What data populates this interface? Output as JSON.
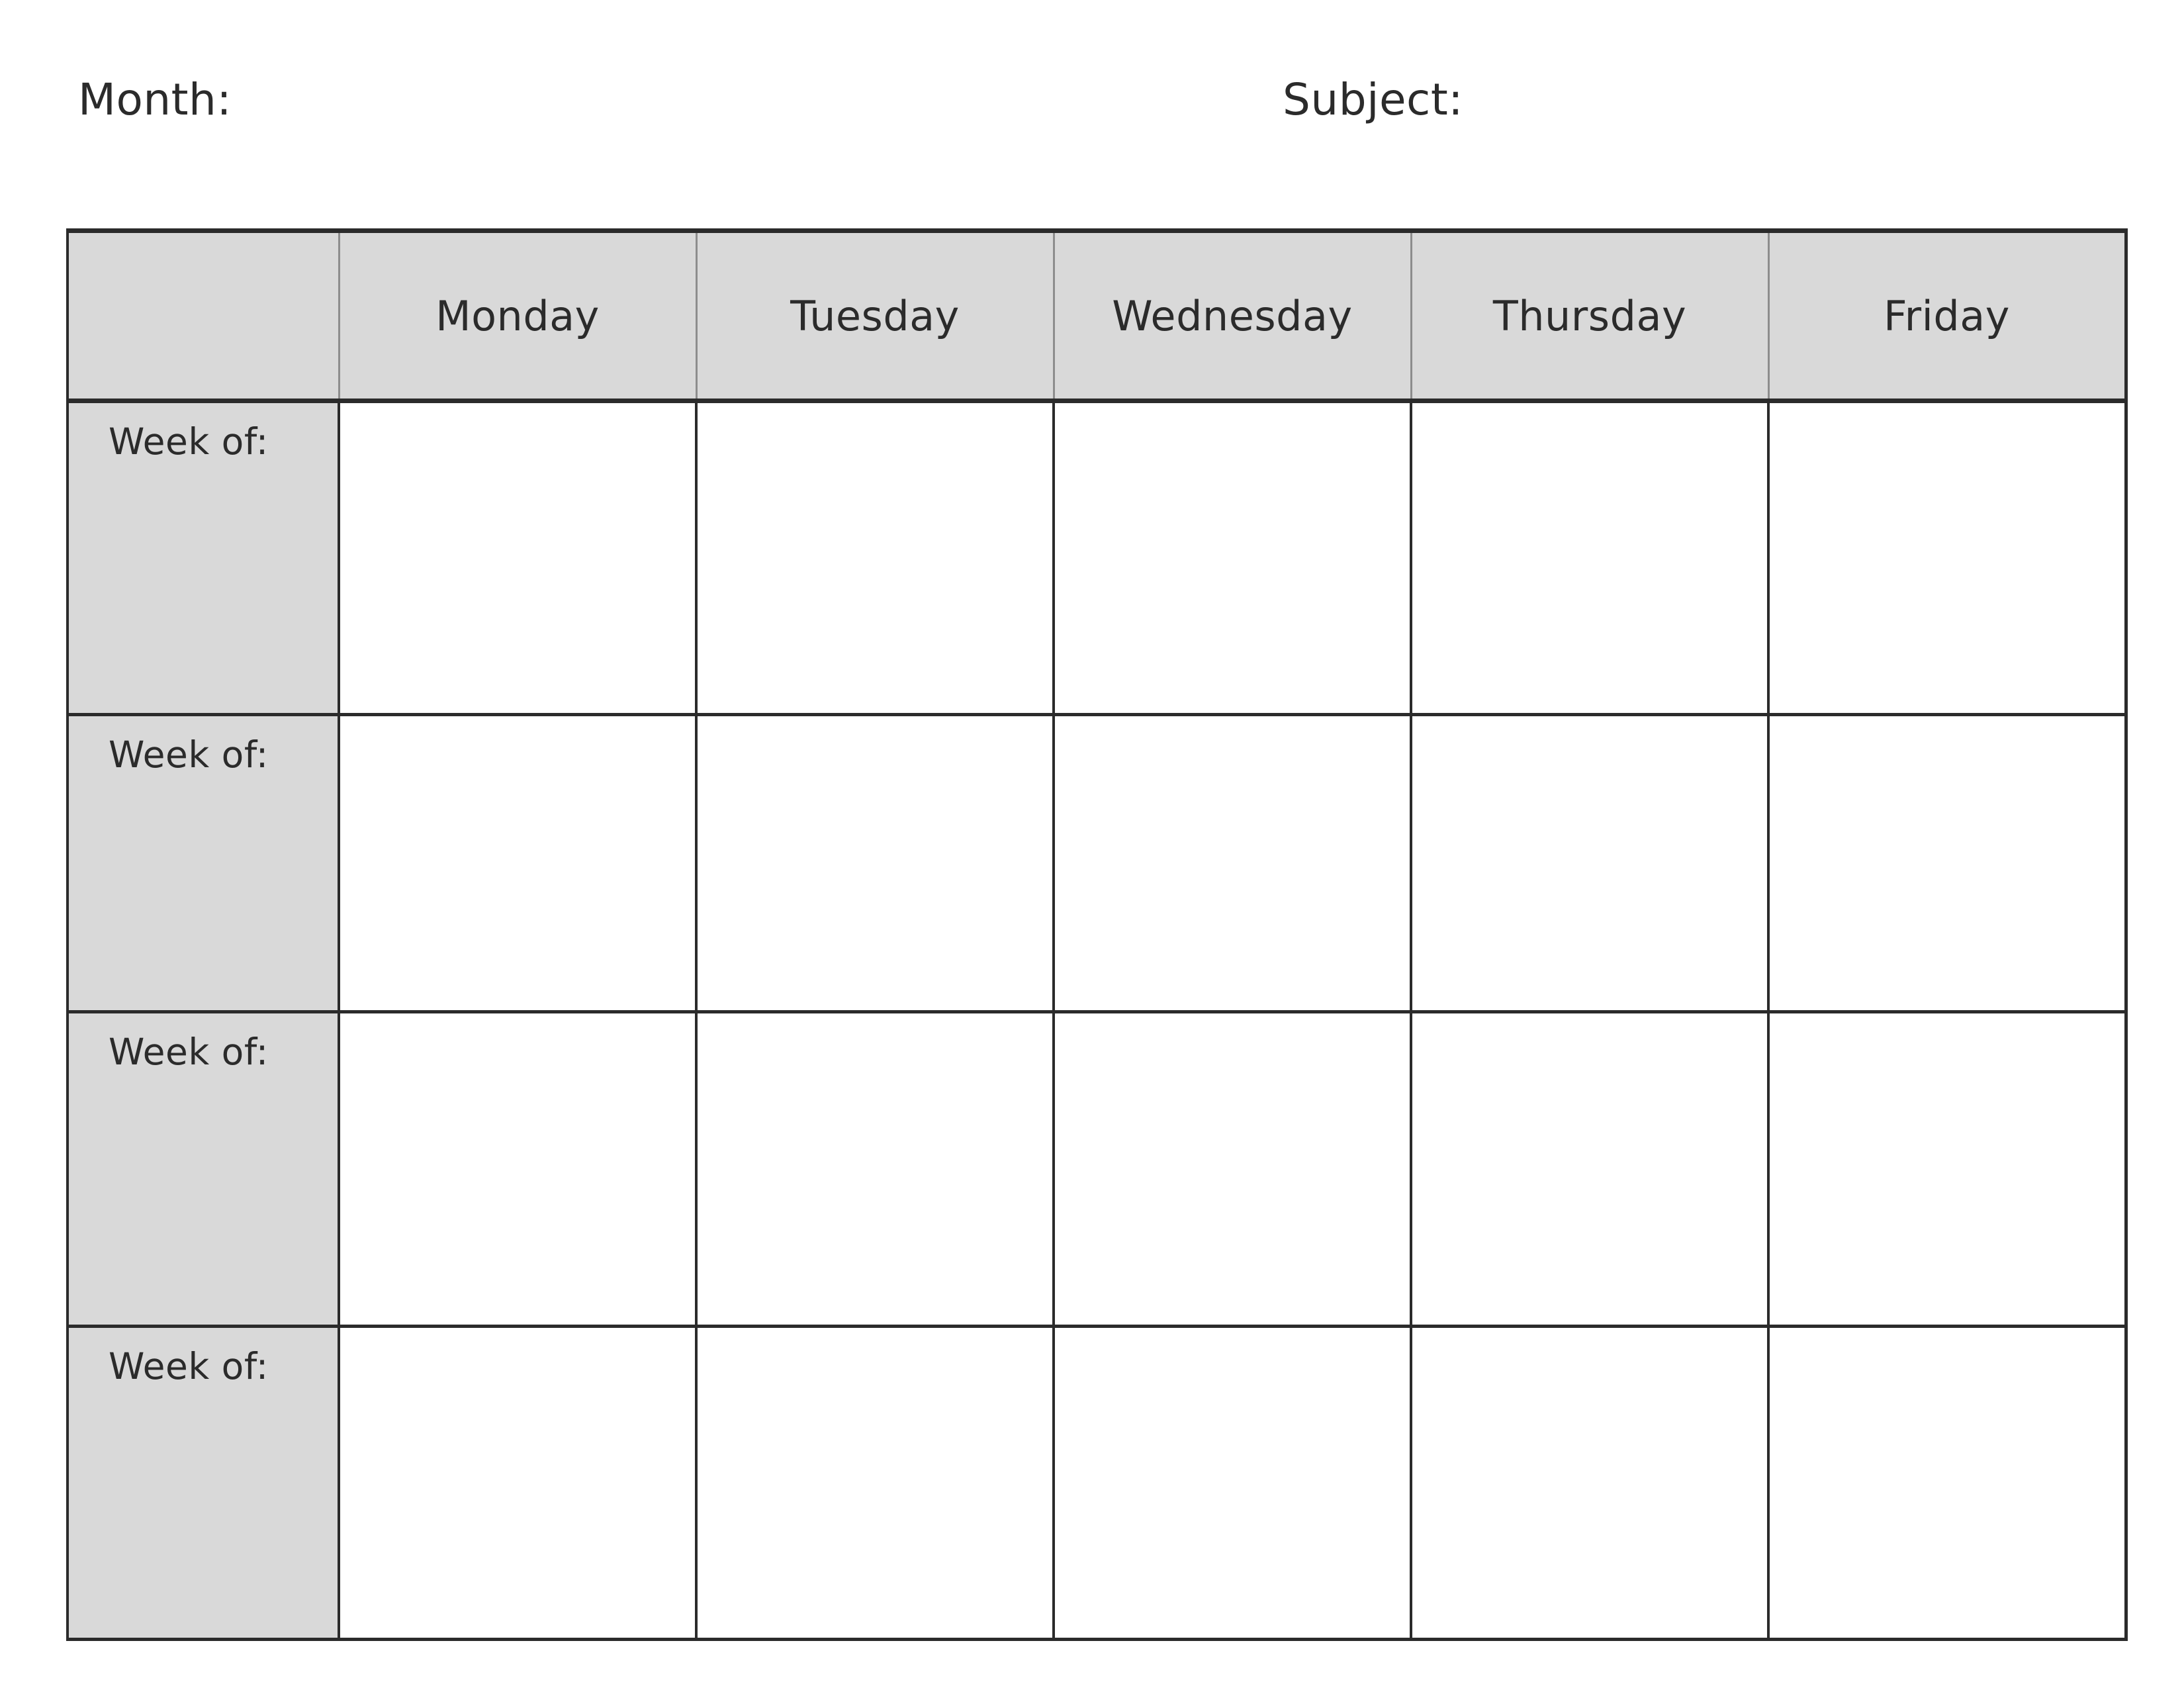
{
  "page": {
    "background_color": "#ffffff",
    "text_color": "#2b2b2b",
    "header_fill_color": "#d9d9d9",
    "border_color": "#2b2b2b"
  },
  "form": {
    "month": {
      "label": "Month:",
      "blank_rule": "________________________",
      "value": ""
    },
    "subject": {
      "label": "Subject:",
      "blank_rule": "_______________________",
      "value": ""
    }
  },
  "table": {
    "corner_label": "",
    "day_headers": [
      "Monday",
      "Tuesday",
      "Wednesday",
      "Thursday",
      "Friday"
    ],
    "rows": [
      {
        "label": "Week of:",
        "value": "",
        "cells": [
          "",
          "",
          "",
          "",
          ""
        ]
      },
      {
        "label": "Week of:",
        "value": "",
        "cells": [
          "",
          "",
          "",
          "",
          ""
        ]
      },
      {
        "label": "Week of:",
        "value": "",
        "cells": [
          "",
          "",
          "",
          "",
          ""
        ]
      },
      {
        "label": "Week of:",
        "value": "",
        "cells": [
          "",
          "",
          "",
          "",
          ""
        ]
      }
    ]
  }
}
